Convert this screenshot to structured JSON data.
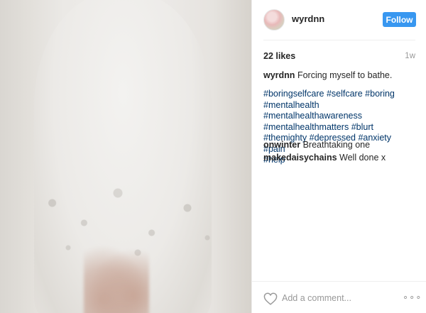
{
  "post": {
    "photo_alt": "bath photo"
  },
  "header": {
    "username": "wyrdnn",
    "follow_label": "Follow",
    "follow_color": "#3897f0"
  },
  "meta": {
    "likes": "22 likes",
    "time_ago": "1w"
  },
  "caption": {
    "author": "wyrdnn",
    "text": "Forcing myself to bathe.",
    "hashtags": [
      "#boringselfcare",
      "#selfcare",
      "#boring",
      "#mentalhealth",
      "#mentalhealthawareness",
      "#mentalhealthmatters",
      "#blurt",
      "#themighty",
      "#depressed",
      "#anxiety",
      "#pain",
      "#help"
    ]
  },
  "comments": [
    {
      "author": "onwinter",
      "text": "Breathtaking one"
    },
    {
      "author": "makedaisychains",
      "text": "Well done x"
    }
  ],
  "footer": {
    "like_icon": "heart-icon",
    "comment_placeholder": "Add a comment...",
    "more_icon": "more-options-icon",
    "more_glyph": "∘∘∘"
  },
  "colors": {
    "hashtag": "#003569",
    "muted": "#999999",
    "text": "#262626"
  }
}
